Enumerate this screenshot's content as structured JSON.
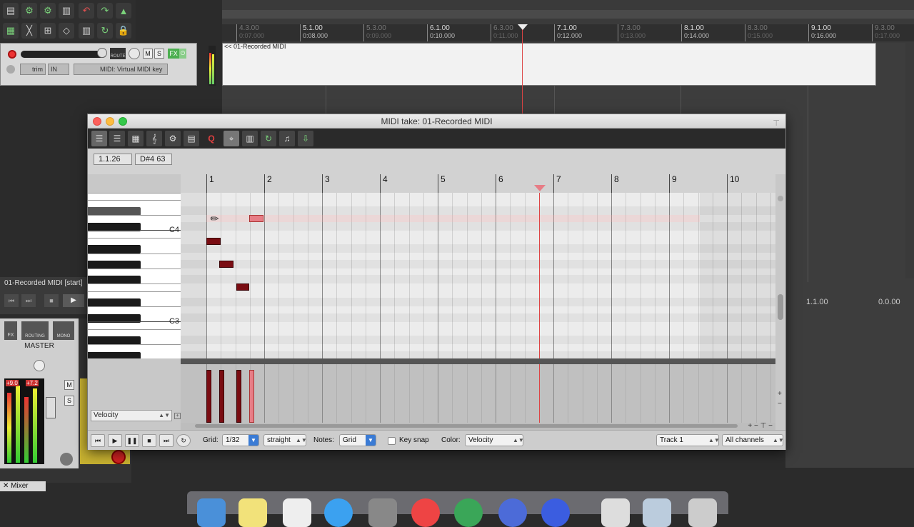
{
  "timeline": {
    "bars": [
      {
        "label": "4.3.00",
        "sub": "0:07.000",
        "minor": true
      },
      {
        "label": "5.1.00",
        "sub": "0:08.000",
        "minor": false
      },
      {
        "label": "5.3.00",
        "sub": "0:09.000",
        "minor": true
      },
      {
        "label": "6.1.00",
        "sub": "0:10.000",
        "minor": false
      },
      {
        "label": "6.3.00",
        "sub": "0:11.000",
        "minor": true
      },
      {
        "label": "7.1.00",
        "sub": "0:12.000",
        "minor": false
      },
      {
        "label": "7.3.00",
        "sub": "0:13.000",
        "minor": true
      },
      {
        "label": "8.1.00",
        "sub": "0:14.000",
        "minor": false
      },
      {
        "label": "8.3.00",
        "sub": "0:15.000",
        "minor": true
      },
      {
        "label": "9.1.00",
        "sub": "0:16.000",
        "minor": false
      },
      {
        "label": "9.3.00",
        "sub": "0:17.000",
        "minor": true
      }
    ],
    "item_label": "<< 01-Recorded MIDI"
  },
  "track": {
    "mute": "M",
    "solo": "S",
    "fx": "FX",
    "route": "ROUTE",
    "trim": "trim",
    "input_mode": "IN",
    "input": "MIDI: Virtual MIDI key"
  },
  "transport": {
    "label": "01-Recorded MIDI [start]"
  },
  "mixer": {
    "master_label": "MASTER",
    "fx": "FX",
    "routing": "ROUTING",
    "mono": "MONO",
    "peak_left": "+9.0",
    "peak_right": "+7.2",
    "mute": "M",
    "solo": "S",
    "tab": "Mixer"
  },
  "status": {
    "position": "1.1.00",
    "time": "0.0.00"
  },
  "midi_editor": {
    "title": "MIDI take: 01-Recorded MIDI",
    "position": "1.1.26",
    "note_info": "D#4  63",
    "bars": [
      "1",
      "2",
      "3",
      "4",
      "5",
      "6",
      "7",
      "8",
      "9",
      "10"
    ],
    "key_labels": {
      "c4": "C4",
      "c3": "C3"
    },
    "velocity_lane": "Velocity",
    "grid_label": "Grid:",
    "grid_value": "1/32",
    "swing_value": "straight",
    "notes_label": "Notes:",
    "notes_value": "Grid",
    "key_snap": "Key snap",
    "color_label": "Color:",
    "color_value": "Velocity",
    "track_value": "Track 1",
    "channel_value": "All channels"
  }
}
